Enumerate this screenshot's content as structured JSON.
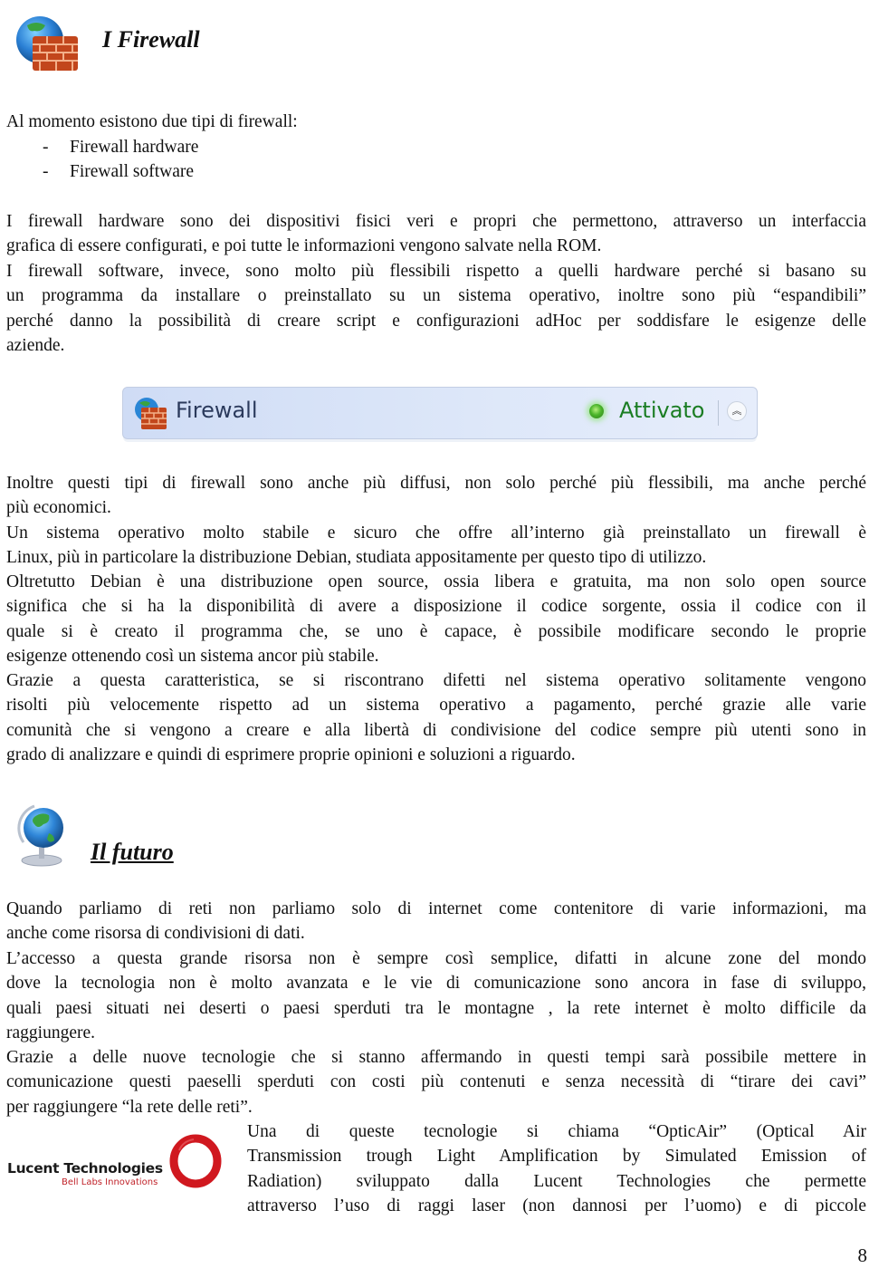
{
  "section1": {
    "icon": "firewall-brick-globe-icon",
    "title": "I Firewall",
    "intro": "Al momento esistono due tipi di firewall:",
    "list": [
      {
        "marker": "-",
        "text": "Firewall hardware"
      },
      {
        "marker": "-",
        "text": "Firewall software"
      }
    ],
    "para1_lines": [
      "I firewall hardware sono dei dispositivi fisici veri e propri che permettono, attraverso un interfaccia",
      "grafica di essere configurati, e poi tutte le informazioni vengono salvate nella ROM."
    ],
    "para2_lines": [
      "I firewall software, invece, sono molto più flessibili rispetto a quelli hardware perché si basano su",
      "un programma da installare o preinstallato su un sistema operativo, inoltre sono più “espandibili”",
      "perché danno la possibilità di creare script e configurazioni adHoc per soddisfare le esigenze delle",
      "aziende."
    ],
    "widget": {
      "icon": "firewall-brick-icon",
      "label": "Firewall",
      "status_icon": "green-status-dot-icon",
      "status": "Attivato",
      "status_color": "#1b7d23",
      "collapse_icon": "double-chevron-up-icon",
      "collapse_glyph": "︽"
    },
    "para3_lines": [
      "Inoltre questi tipi di firewall sono anche più diffusi, non solo perché più flessibili, ma anche perché",
      "più economici."
    ],
    "para4_lines": [
      "Un sistema operativo molto stabile e sicuro che offre all’interno già preinstallato un firewall è",
      "Linux, più in particolare la distribuzione Debian, studiata appositamente per questo tipo di utilizzo."
    ],
    "para5_lines": [
      "Oltretutto Debian è una distribuzione open source, ossia libera e gratuita,  ma non solo open source",
      "significa  che si ha la disponibilità di avere a disposizione il codice sorgente, ossia il codice con il",
      "quale si è creato il programma che, se uno è capace, è possibile modificare secondo le proprie",
      "esigenze ottenendo così un sistema ancor più stabile."
    ],
    "para6_lines": [
      "Grazie a questa caratteristica, se si riscontrano difetti nel sistema operativo solitamente vengono",
      "risolti più velocemente rispetto ad un sistema operativo a pagamento, perché grazie alle varie",
      "comunità che si vengono a creare e alla libertà di condivisione del codice sempre più utenti sono in",
      "grado di analizzare e quindi di esprimere proprie opinioni e soluzioni a riguardo."
    ]
  },
  "section2": {
    "icon": "globe-icon",
    "title": "Il futuro",
    "para1_lines": [
      "Quando parliamo di reti non parliamo solo di internet come contenitore di varie informazioni, ma",
      "anche come risorsa di condivisioni di dati."
    ],
    "para2_lines": [
      "L’accesso a questa grande risorsa non è sempre così semplice, difatti in alcune zone del mondo",
      "dove la tecnologia non è molto avanzata e le vie di comunicazione sono ancora in fase di sviluppo,",
      "quali paesi situati nei deserti o paesi sperduti tra le montagne , la rete internet  è molto difficile da",
      "raggiungere."
    ],
    "para3_lines": [
      "Grazie a delle nuove tecnologie che si stanno affermando in questi tempi sarà possibile mettere in",
      "comunicazione questi paeselli sperduti con costi più contenuti e senza necessità di “tirare dei cavi”",
      "per raggiungere “la rete delle reti”."
    ],
    "logo": {
      "name": "Lucent Technologies",
      "tagline": "Bell Labs Innovations",
      "brand_color": "#d0181f"
    },
    "para4_lines": [
      "Una di queste tecnologie si chiama “OpticAir” (Optical Air",
      "Transmission trough Light Amplification by Simulated Emission of",
      "Radiation) sviluppato dalla Lucent Technologies che permette",
      "attraverso l’uso di raggi laser (non dannosi per l’uomo) e di piccole"
    ]
  },
  "page_number": "8"
}
